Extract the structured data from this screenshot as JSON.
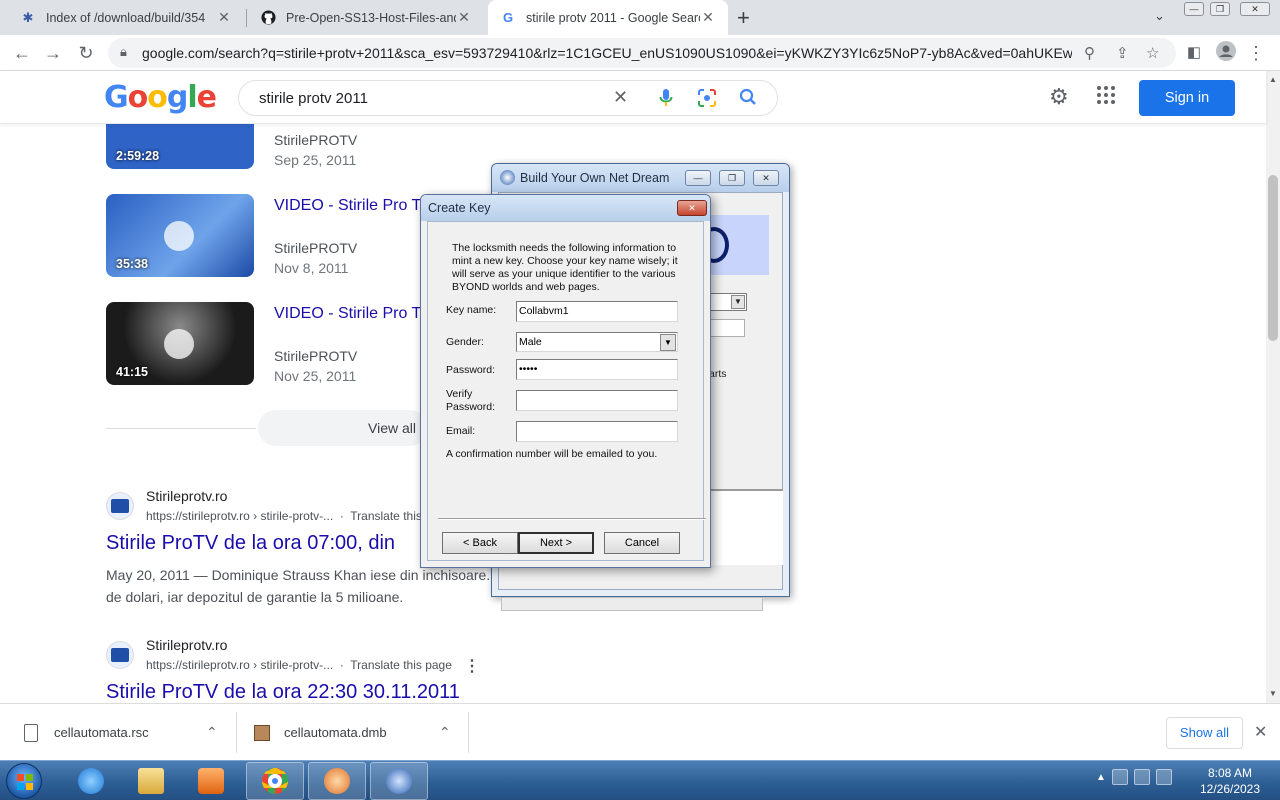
{
  "browser": {
    "tabs": [
      {
        "title": "Index of /download/build/354",
        "active": false,
        "icon": "byond-star-icon"
      },
      {
        "title": "Pre-Open-SS13-Host-Files-and-S",
        "active": false,
        "icon": "github-icon"
      },
      {
        "title": "stirile protv 2011 - Google Searc",
        "active": true,
        "icon": "google-g-icon"
      }
    ],
    "url": "google.com/search?q=stirile+protv+2011&sca_esv=593729410&rlz=1C1GCEU_enUS1090US1090&ei=yKWKZY3YIc6z5NoP7-yb8Ac&ved=0ahUKEwi..."
  },
  "google": {
    "logo": "Google",
    "query": "stirile protv 2011",
    "sign_in": "Sign in",
    "logo_colors": [
      "#4285f4",
      "#ea4335",
      "#fbbc05",
      "#4285f4",
      "#34a853",
      "#ea4335"
    ]
  },
  "videos": [
    {
      "title": "",
      "source": "StirilePROTV",
      "date": "Sep 25, 2011",
      "duration": "2:59:28",
      "thumb_color": "#2f63c6"
    },
    {
      "title": "VIDEO - Stirile Pro TV",
      "source": "StirilePROTV",
      "date": "Nov 8, 2011",
      "duration": "35:38",
      "thumb_color": "#2a5fc2"
    },
    {
      "title": "VIDEO - Stirile Pro TV",
      "source": "StirilePROTV",
      "date": "Nov 25, 2011",
      "duration": "41:15",
      "thumb_color": "#1b1b1b"
    }
  ],
  "view_all": "View all",
  "results": [
    {
      "site": "Stirileprotv.ro",
      "url": "https://stirileprotv.ro › stirile-protv-...",
      "translate": "Translate this",
      "title": "Stirile ProTV de la ora 07:00, din",
      "snippet": "May 20, 2011 — Dominique Strauss Khan iese din inchisoare. O",
      "snippet2": "de dolari, iar depozitul de garantie la 5 milioane."
    },
    {
      "site": "Stirileprotv.ro",
      "url": "https://stirileprotv.ro › stirile-protv-...",
      "translate": "Translate this page",
      "title": "Stirile ProTV de la ora 22:30 30.11.2011"
    }
  ],
  "downloads": [
    {
      "name": "cellautomata.rsc"
    },
    {
      "name": "cellautomata.dmb"
    }
  ],
  "show_all": "Show all",
  "byond_window": {
    "title": "Build Your Own Net Dream",
    "partial_text": "arts"
  },
  "dialog": {
    "title": "Create Key",
    "message": "The locksmith needs the following information to mint a new key.  Choose your key name wisely; it will serve as your unique identifier to the various BYOND worlds and web pages.",
    "key_name_label": "Key name:",
    "key_name_value": "Collabvm1",
    "gender_label": "Gender:",
    "gender_value": "Male",
    "password_label": "Password:",
    "password_value": "•••••",
    "verify_label_1": "Verify",
    "verify_label_2": "Password:",
    "verify_value": "",
    "email_label": "Email:",
    "email_value": "",
    "confirmation": "A confirmation number will be emailed to you.",
    "back": "< Back",
    "next": "Next >",
    "cancel": "Cancel"
  },
  "taskbar": {
    "time": "8:08 AM",
    "date": "12/26/2023"
  }
}
